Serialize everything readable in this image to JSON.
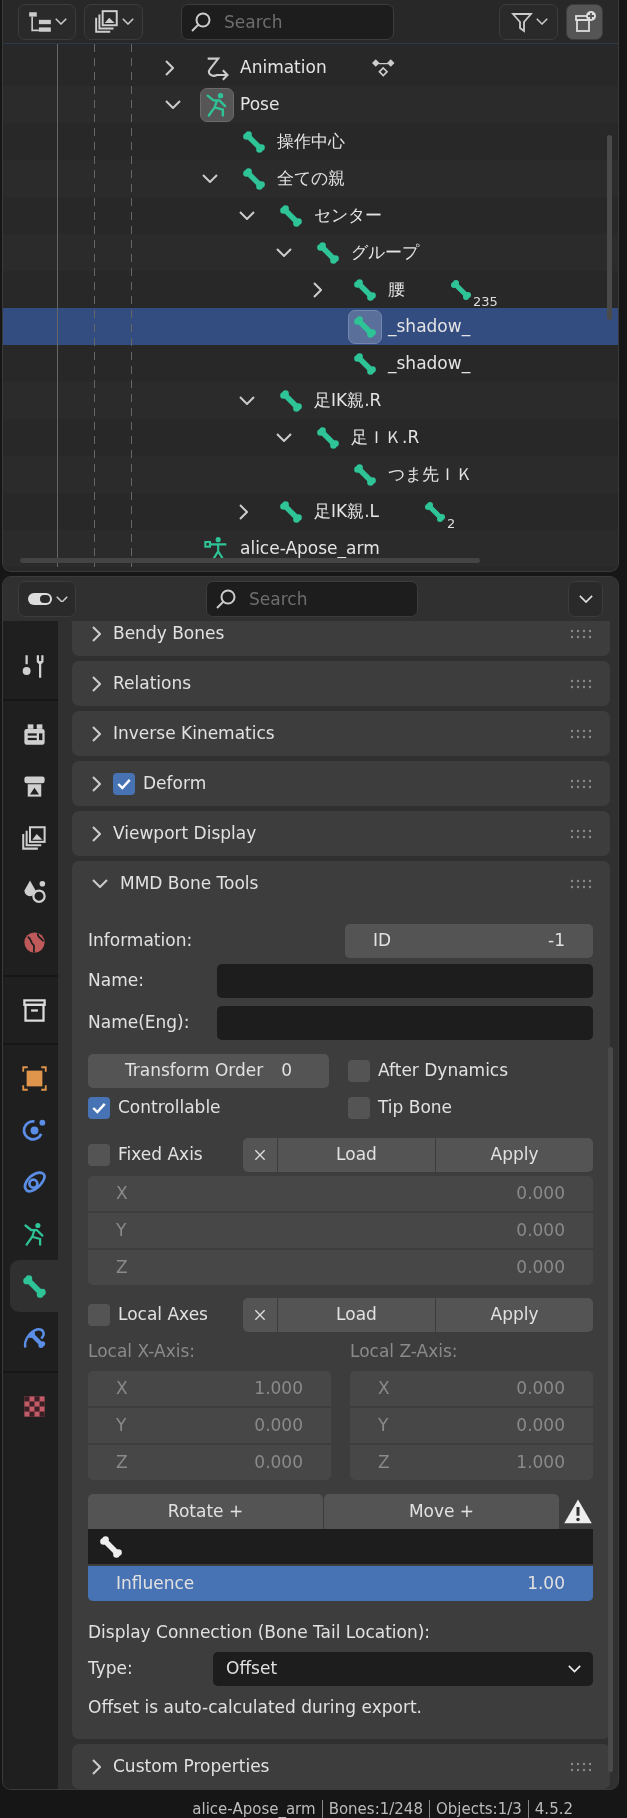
{
  "outliner": {
    "search": {
      "placeholder": "Search"
    },
    "tree": [
      {
        "name": "Animation",
        "kind": "animation",
        "expanded": false,
        "selected": false,
        "active": false,
        "badge": {
          "kind": "keyframes"
        }
      },
      {
        "name": "Pose",
        "kind": "pose",
        "expanded": true,
        "selected": false,
        "active": true,
        "children": [
          {
            "name": "操作中心",
            "kind": "bone",
            "selected": false,
            "active": false
          },
          {
            "name": "全ての親",
            "kind": "bone",
            "expanded": true,
            "selected": false,
            "active": false,
            "children": [
              {
                "name": "センター",
                "kind": "bone",
                "expanded": true,
                "selected": false,
                "active": false,
                "children": [
                  {
                    "name": "グループ",
                    "kind": "bone",
                    "expanded": true,
                    "selected": false,
                    "active": false,
                    "children": [
                      {
                        "name": "腰",
                        "kind": "bone",
                        "expanded": false,
                        "selected": false,
                        "active": false,
                        "badge": {
                          "kind": "bone",
                          "count": "235"
                        }
                      },
                      {
                        "name": "_shadow_",
                        "kind": "bone",
                        "selected": true,
                        "active": true
                      },
                      {
                        "name": "_shadow_",
                        "kind": "bone",
                        "selected": false,
                        "active": false
                      }
                    ]
                  }
                ]
              },
              {
                "name": "足IK親.R",
                "kind": "bone",
                "expanded": true,
                "selected": false,
                "active": false,
                "children": [
                  {
                    "name": "足ＩＫ.R",
                    "kind": "bone",
                    "expanded": true,
                    "selected": false,
                    "active": false,
                    "children": [
                      {
                        "name": "つま先ＩＫ",
                        "kind": "bone",
                        "selected": false,
                        "active": false
                      }
                    ]
                  }
                ]
              },
              {
                "name": "足IK親.L",
                "kind": "bone",
                "expanded": false,
                "selected": false,
                "active": false,
                "badge": {
                  "kind": "bone",
                  "count": "2"
                }
              }
            ]
          }
        ]
      },
      {
        "name": "alice-Apose_arm",
        "kind": "armature",
        "selected": false,
        "active": false
      }
    ]
  },
  "properties": {
    "search": {
      "placeholder": "Search"
    },
    "tab_groups": [
      [
        {
          "kind": "tool",
          "selected": false
        }
      ],
      [
        {
          "kind": "render",
          "selected": false
        },
        {
          "kind": "output",
          "selected": false
        },
        {
          "kind": "view_layer",
          "selected": false
        },
        {
          "kind": "scene",
          "selected": false
        },
        {
          "kind": "world",
          "selected": false
        }
      ],
      [
        {
          "kind": "collection",
          "selected": false
        }
      ],
      [
        {
          "kind": "object",
          "selected": false
        },
        {
          "kind": "physics",
          "selected": false
        },
        {
          "kind": "constraints",
          "selected": false
        },
        {
          "kind": "data",
          "selected": false
        },
        {
          "kind": "bone",
          "selected": true
        },
        {
          "kind": "bone_constraint",
          "selected": false
        }
      ],
      [
        {
          "kind": "texture",
          "selected": false
        }
      ]
    ],
    "panels": [
      {
        "title": "Bendy Bones",
        "expanded": false
      },
      {
        "title": "Relations",
        "expanded": false
      },
      {
        "title": "Inverse Kinematics",
        "expanded": false
      },
      {
        "title": "Deform",
        "expanded": false,
        "checkbox": {
          "checked": true
        }
      },
      {
        "title": "Viewport Display",
        "expanded": false
      },
      {
        "title": "MMD Bone Tools",
        "expanded": true,
        "kind": "mmd"
      },
      {
        "title": "Custom Properties",
        "expanded": false
      }
    ],
    "mmd": {
      "information": {
        "label": "Information:",
        "field": "ID",
        "value": "-1"
      },
      "name": {
        "label": "Name:"
      },
      "name_eng": {
        "label": "Name(Eng):"
      },
      "transform_order": {
        "label": "Transform Order",
        "value": "0"
      },
      "after_dynamics": {
        "label": "After Dynamics",
        "checked": false
      },
      "controllable": {
        "label": "Controllable",
        "checked": true
      },
      "tip_bone": {
        "label": "Tip Bone",
        "checked": false
      },
      "fixed_axis": {
        "label": "Fixed Axis",
        "checked": false,
        "load": "Load",
        "apply": "Apply",
        "disabled": true,
        "fields": [
          {
            "axis": "X",
            "value": "0.000"
          },
          {
            "axis": "Y",
            "value": "0.000"
          },
          {
            "axis": "Z",
            "value": "0.000"
          }
        ]
      },
      "local_axes": {
        "label": "Local Axes",
        "checked": false,
        "load": "Load",
        "apply": "Apply"
      },
      "local_axis_columns": [
        {
          "label": "Local X-Axis:",
          "disabled": true,
          "fields": [
            {
              "axis": "X",
              "value": "1.000"
            },
            {
              "axis": "Y",
              "value": "0.000"
            },
            {
              "axis": "Z",
              "value": "0.000"
            }
          ]
        },
        {
          "label": "Local Z-Axis:",
          "disabled": true,
          "fields": [
            {
              "axis": "X",
              "value": "0.000"
            },
            {
              "axis": "Y",
              "value": "0.000"
            },
            {
              "axis": "Z",
              "value": "1.000"
            }
          ]
        }
      ],
      "buttons": [
        "Rotate +",
        "Move +"
      ],
      "warning": true,
      "influence": {
        "label": "Influence",
        "value": "1.00",
        "level": 1
      },
      "display_connection": "Display Connection (Bone Tail Location):",
      "type": {
        "label": "Type:",
        "value": "Offset"
      },
      "note": "Offset is auto-calculated during export."
    }
  },
  "status_bar": [
    "alice-Apose_arm",
    "Bones:1/248",
    "Objects:1/3",
    "4.5.2"
  ]
}
